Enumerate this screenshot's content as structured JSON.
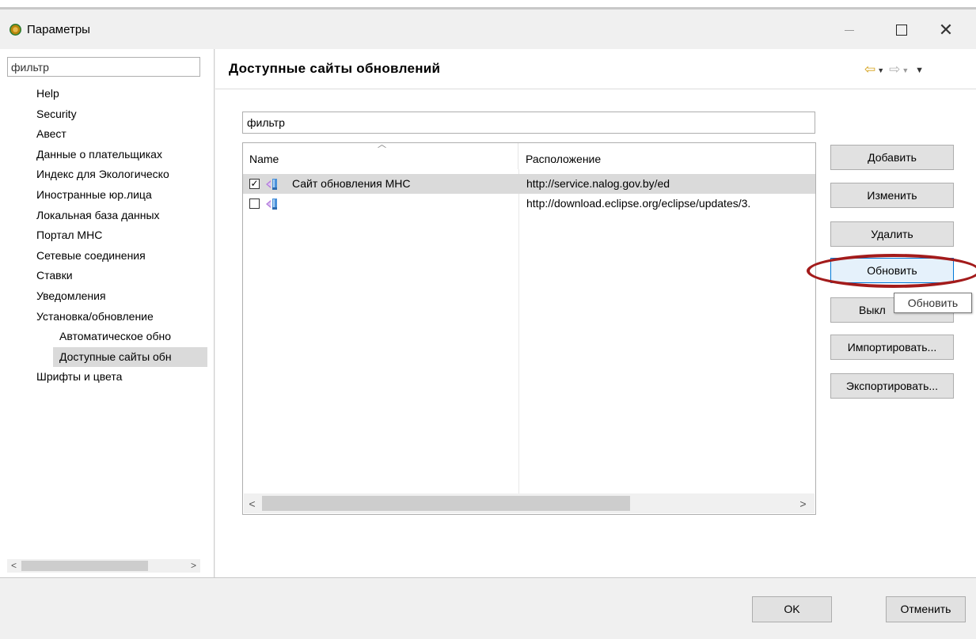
{
  "window": {
    "title": "Параметры",
    "close_glyph": "✕"
  },
  "sidebar": {
    "filter_value": "фильтр",
    "items": [
      {
        "label": "Help",
        "level": 0
      },
      {
        "label": "Security",
        "level": 0
      },
      {
        "label": "Авест",
        "level": 0
      },
      {
        "label": "Данные о плательщиках",
        "level": 0
      },
      {
        "label": "Индекс для Экологическо",
        "level": 0
      },
      {
        "label": "Иностранные юр.лица",
        "level": 0
      },
      {
        "label": "Локальная база данных",
        "level": 0
      },
      {
        "label": "Портал МНС",
        "level": 0
      },
      {
        "label": "Сетевые соединения",
        "level": 0
      },
      {
        "label": "Ставки",
        "level": 0
      },
      {
        "label": "Уведомления",
        "level": 0
      },
      {
        "label": "Установка/обновление",
        "level": 0
      },
      {
        "label": "Автоматическое обно",
        "level": 1
      },
      {
        "label": "Доступные сайты обн",
        "level": 1,
        "selected": true
      },
      {
        "label": "Шрифты и цвета",
        "level": 0
      }
    ]
  },
  "main": {
    "title": "Доступные сайты обновлений",
    "filter_value": "фильтр",
    "table": {
      "columns": [
        "Name",
        "Расположение"
      ],
      "rows": [
        {
          "checked": true,
          "name": "Сайт обновления МНС",
          "location": "http://service.nalog.gov.by/ed",
          "selected": true
        },
        {
          "checked": false,
          "name": "",
          "location": "http://download.eclipse.org/eclipse/updates/3.",
          "selected": false
        }
      ]
    },
    "buttons": {
      "add": "Добавить",
      "edit": "Изменить",
      "remove": "Удалить",
      "reload": "Обновить",
      "disable": "Выкл",
      "import": "Импортировать...",
      "export": "Экспортировать..."
    },
    "tooltip": "Обновить"
  },
  "footer": {
    "ok": "OK",
    "cancel": "Отменить"
  },
  "colors": {
    "highlight": "#a31b1b",
    "selection": "#dadada",
    "focus_border": "#0078d7",
    "nav_back": "#d4a017"
  }
}
